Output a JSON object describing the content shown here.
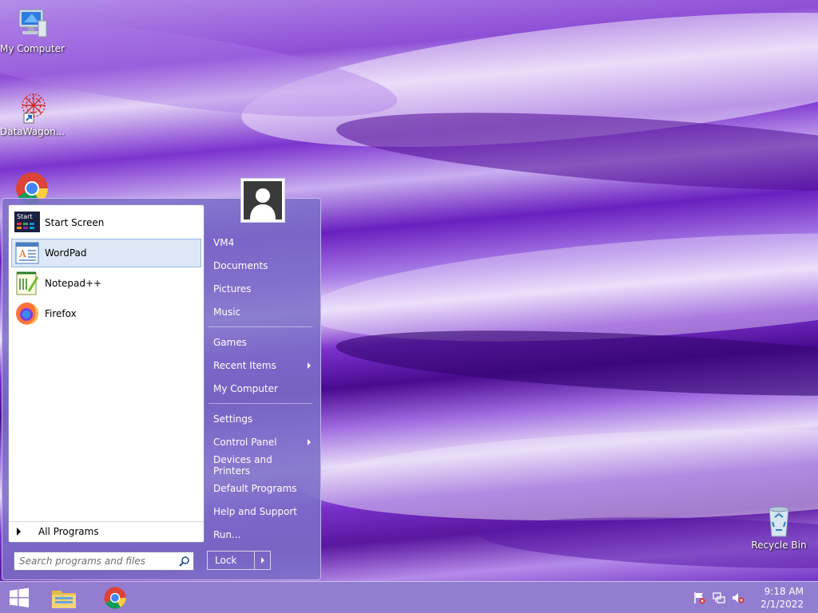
{
  "desktop": {
    "icons": [
      {
        "label": "My Computer",
        "icon": "computer-icon"
      },
      {
        "label": "DataWagon...",
        "icon": "datawagon-icon"
      },
      {
        "label": "",
        "icon": "chrome-icon"
      },
      {
        "label": "Recycle Bin",
        "icon": "recycle-bin-icon"
      }
    ]
  },
  "start_menu": {
    "programs": [
      {
        "label": "Start Screen",
        "icon": "start-screen-icon"
      },
      {
        "label": "WordPad",
        "icon": "wordpad-icon",
        "selected": true
      },
      {
        "label": "Notepad++",
        "icon": "notepadpp-icon"
      },
      {
        "label": "Firefox",
        "icon": "firefox-icon"
      }
    ],
    "start_screen_icon_text": "Start",
    "all_programs": "All Programs",
    "search_placeholder": "Search programs and files",
    "right_items": {
      "user": "VM4",
      "documents": "Documents",
      "pictures": "Pictures",
      "music": "Music",
      "games": "Games",
      "recent_items": "Recent Items",
      "my_computer": "My Computer",
      "settings": "Settings",
      "control_panel": "Control Panel",
      "devices_printers": "Devices and Printers",
      "default_programs": "Default Programs",
      "help_support": "Help and Support",
      "run": "Run..."
    },
    "lock_label": "Lock"
  },
  "taskbar": {
    "pinned": [
      "start-button",
      "file-explorer-icon",
      "chrome-icon"
    ],
    "time": "9:18 AM",
    "date": "2/1/2022"
  },
  "colors": {
    "menu_bg": "#7d6ec8",
    "selection": "#dce8f6",
    "taskbar": "#9682d2"
  }
}
